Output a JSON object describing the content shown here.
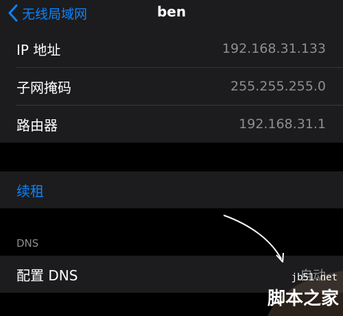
{
  "nav": {
    "back_label": "无线局域网",
    "title": "ben"
  },
  "network_info": [
    {
      "label": "IP 地址",
      "value": "192.168.31.133"
    },
    {
      "label": "子网掩码",
      "value": "255.255.255.0"
    },
    {
      "label": "路由器",
      "value": "192.168.31.1"
    }
  ],
  "renew": {
    "label": "续租"
  },
  "dns": {
    "section_header": "DNS",
    "configure_label": "配置 DNS",
    "configure_value": "自动"
  },
  "watermark": {
    "site": "jb51.net",
    "name": "脚本之家"
  },
  "colors": {
    "accent": "#0a84ff",
    "cell_background": "#1c1c1e",
    "secondary_text": "#8e8e93"
  }
}
